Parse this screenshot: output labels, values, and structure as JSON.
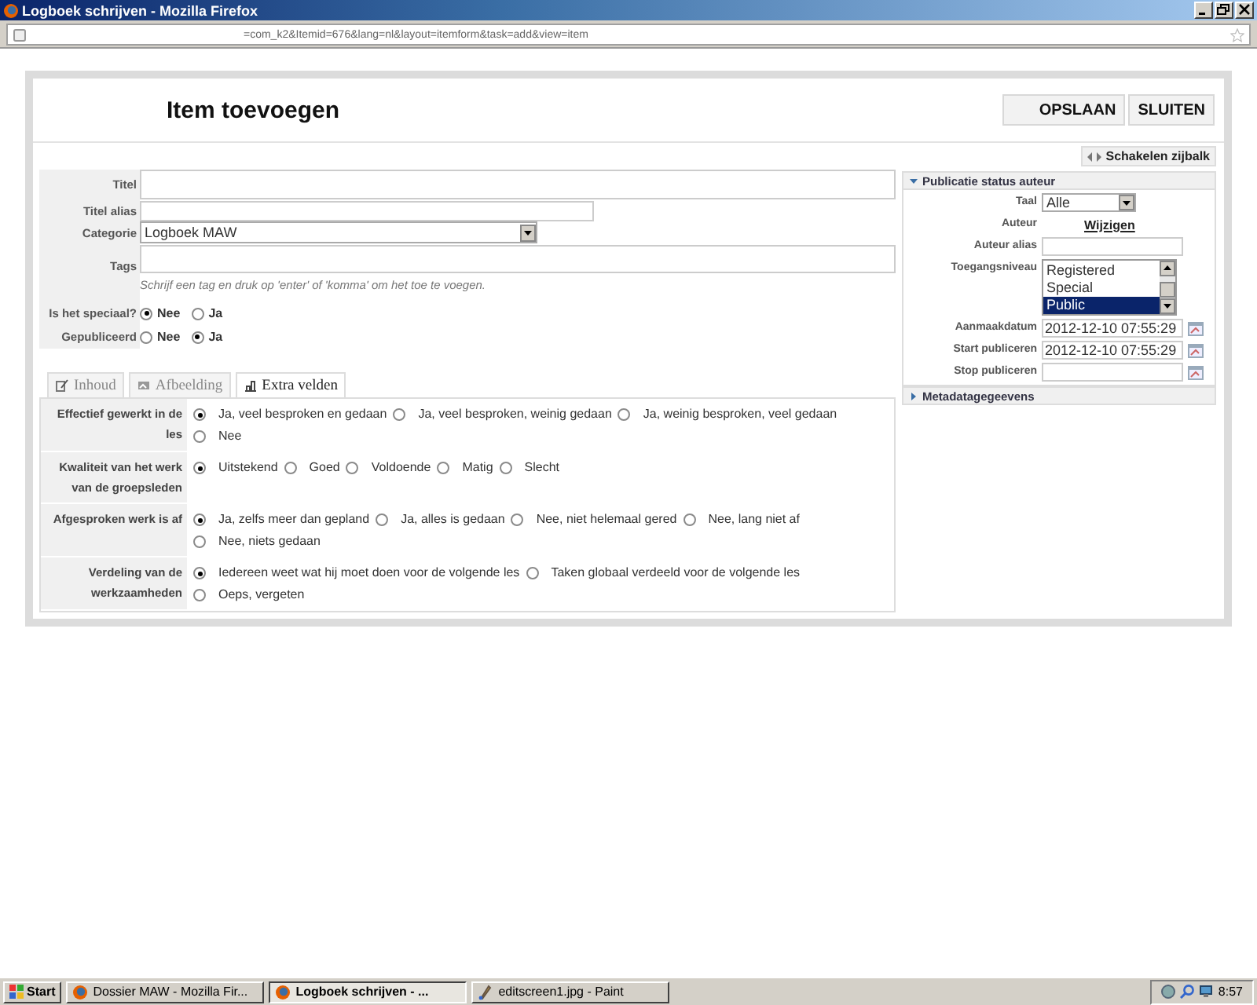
{
  "browser": {
    "title": "Logboek schrijven - Mozilla Firefox",
    "url": "=com_k2&Itemid=676&lang=nl&layout=itemform&task=add&view=item"
  },
  "page": {
    "heading": "Item toevoegen",
    "buttons": [
      "OPSLAAN",
      "SLUITEN"
    ]
  },
  "form": {
    "title": {
      "label": "Titel"
    },
    "alias": {
      "label": "Titel alias"
    },
    "category": {
      "label": "Categorie",
      "value": "Logboek MAW"
    },
    "tags": {
      "label": "Tags",
      "hint": "Schrijf een tag en druk op 'enter' of 'komma' om het toe te voegen."
    },
    "switches": [
      {
        "label": "Is het speciaal?",
        "options": [
          {
            "label": "Nee",
            "selected": true
          },
          {
            "label": "Ja",
            "selected": false
          }
        ]
      },
      {
        "label": "Gepubliceerd",
        "options": [
          {
            "label": "Nee",
            "selected": false
          },
          {
            "label": "Ja",
            "selected": true
          }
        ]
      }
    ]
  },
  "tabs": [
    {
      "label": "Inhoud",
      "selected": false
    },
    {
      "label": "Afbeelding",
      "selected": false
    },
    {
      "label": "Extra velden",
      "selected": true
    }
  ],
  "extra_fields": [
    {
      "label": "Effectief gewerkt in de les",
      "options": [
        {
          "label": "Ja, veel besproken en gedaan",
          "selected": true
        },
        {
          "label": "Ja, veel besproken, weinig gedaan",
          "selected": false
        },
        {
          "label": "Ja, weinig besproken, veel gedaan",
          "selected": false
        },
        {
          "label": "Nee",
          "selected": false
        }
      ]
    },
    {
      "label": "Kwaliteit van het werk van de groepsleden",
      "options": [
        {
          "label": "Uitstekend",
          "selected": true
        },
        {
          "label": "Goed",
          "selected": false
        },
        {
          "label": "Voldoende",
          "selected": false
        },
        {
          "label": "Matig",
          "selected": false
        },
        {
          "label": "Slecht",
          "selected": false
        }
      ]
    },
    {
      "label": "Afgesproken werk is af",
      "options": [
        {
          "label": "Ja, zelfs meer dan gepland",
          "selected": true
        },
        {
          "label": "Ja, alles is gedaan",
          "selected": false
        },
        {
          "label": "Nee, niet helemaal gered",
          "selected": false
        },
        {
          "label": "Nee, lang niet af",
          "selected": false
        },
        {
          "label": "Nee, niets gedaan",
          "selected": false
        }
      ]
    },
    {
      "label": "Verdeling van de werkzaamheden",
      "options": [
        {
          "label": "Iedereen weet wat hij moet doen voor de volgende les",
          "selected": true
        },
        {
          "label": "Taken globaal verdeeld voor de volgende les",
          "selected": false
        },
        {
          "label": "Oeps, vergeten",
          "selected": false
        }
      ]
    }
  ],
  "sidebar": {
    "toggle": "Schakelen zijbalk",
    "panels": [
      {
        "title": "Publicatie status auteur",
        "expanded": true
      },
      {
        "title": "Metadatagegeevens",
        "expanded": false
      }
    ],
    "rows": [
      {
        "kind": "select",
        "label": "Taal",
        "value": "Alle"
      },
      {
        "kind": "link",
        "label": "Auteur",
        "value": "Wijzigen"
      },
      {
        "kind": "text",
        "label": "Auteur alias"
      },
      {
        "kind": "list",
        "label": "Toegangsniveau",
        "options": [
          {
            "label": "Registered",
            "selected": false
          },
          {
            "label": "Special",
            "selected": false
          },
          {
            "label": "Public",
            "selected": true
          }
        ]
      },
      {
        "kind": "date",
        "label": "Aanmaakdatum",
        "value": "2012-12-10 07:55:29"
      },
      {
        "kind": "date",
        "label": "Start publiceren",
        "value": "2012-12-10 07:55:29"
      },
      {
        "kind": "date",
        "label": "Stop publiceren"
      }
    ]
  },
  "taskbar": {
    "start": "Start",
    "items": [
      {
        "label": "Dossier MAW - Mozilla Fir...",
        "kind": "browser",
        "selected": false
      },
      {
        "label": "Logboek schrijven - ...",
        "kind": "browser",
        "selected": true
      },
      {
        "label": "editscreen1.jpg - Paint",
        "kind": "paint",
        "selected": false
      }
    ],
    "clock": "8:57"
  }
}
